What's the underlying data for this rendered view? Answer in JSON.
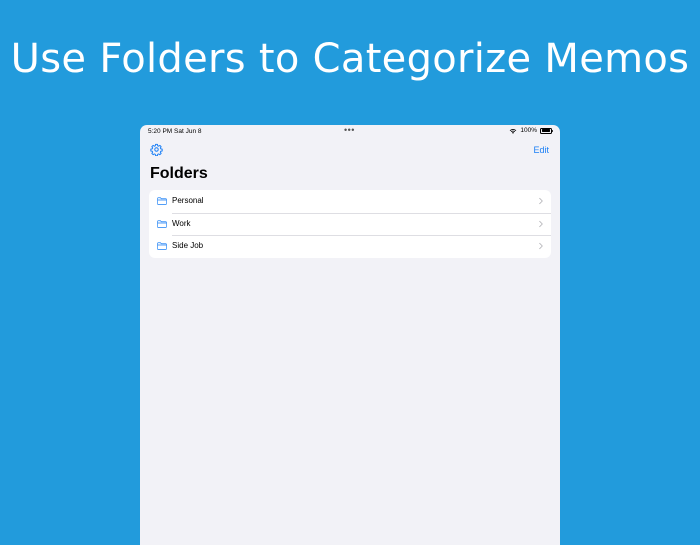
{
  "headline": "Use Folders to Categorize Memos",
  "status_bar": {
    "time": "5:20 PM   Sat Jun 8",
    "battery": "100%"
  },
  "nav": {
    "edit_label": "Edit"
  },
  "title": "Folders",
  "folders": [
    {
      "label": "Personal"
    },
    {
      "label": "Work"
    },
    {
      "label": "Side Job"
    }
  ],
  "colors": {
    "background": "#229bdc",
    "accent": "#1b7ff5",
    "app_background": "#f2f2f7"
  }
}
